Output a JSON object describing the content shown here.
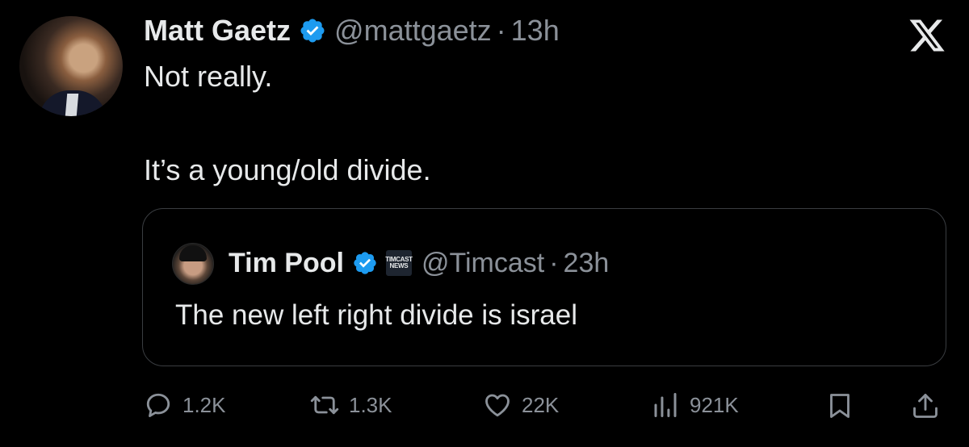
{
  "tweet": {
    "author_name": "Matt Gaetz",
    "handle": "@mattgaetz",
    "separator": "·",
    "time": "13h",
    "lines": [
      "Not really.",
      "It’s a young/old divide."
    ]
  },
  "quoted": {
    "author_name": "Tim Pool",
    "affiliate_badge_text": [
      "TIMCAST",
      "NEWS"
    ],
    "handle": "@Timcast",
    "separator": "·",
    "time": "23h",
    "text": "The new left right divide is israel"
  },
  "actions": {
    "replies": "1.2K",
    "reposts": "1.3K",
    "likes": "22K",
    "views": "921K"
  },
  "icons": {
    "logo": "x-logo-icon",
    "verified": "verified-badge-icon",
    "reply": "reply-icon",
    "repost": "repost-icon",
    "like": "heart-icon",
    "views": "views-icon",
    "bookmark": "bookmark-icon",
    "share": "share-icon"
  },
  "colors": {
    "background": "#000000",
    "text": "#e7e9ea",
    "secondary_text": "#8b9199",
    "verified_blue": "#1d9bf0",
    "border": "#3a3d41"
  }
}
